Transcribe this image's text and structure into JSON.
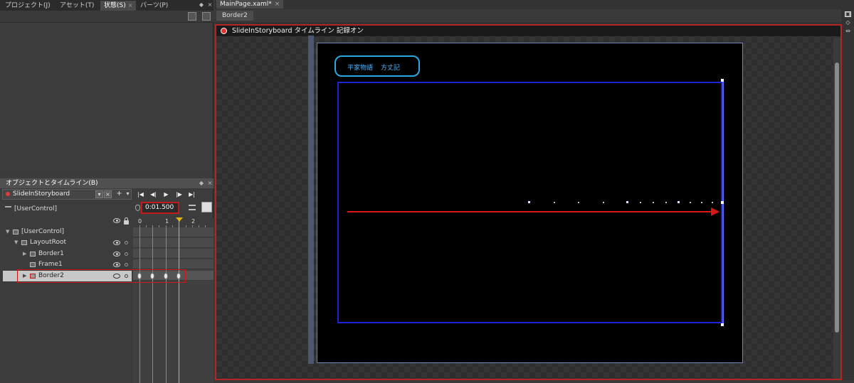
{
  "top_tabs": [
    {
      "label": "プロジェクト(J)"
    },
    {
      "label": "アセット(T)"
    },
    {
      "label": "状態(S)"
    },
    {
      "label": "パーツ(P)"
    }
  ],
  "objects_panel": {
    "title": "オブジェクトとタイムライン(B)",
    "storyboard": "SlideInStoryboard",
    "root": "[UserControl]",
    "time": "0:01.500",
    "ruler": [
      "0",
      "1",
      "2"
    ],
    "tree": [
      {
        "label": "[UserControl]"
      },
      {
        "label": "LayoutRoot"
      },
      {
        "label": "Border1"
      },
      {
        "label": "Frame1"
      },
      {
        "label": "Border2"
      }
    ]
  },
  "document": {
    "tab": "MainPage.xaml*",
    "breadcrumb": "Border2",
    "recording_banner": "SlideInStoryboard タイムライン 記録オン",
    "nav_links": [
      "平家物語",
      "方丈記"
    ]
  },
  "colors": {
    "record": "#e53434",
    "highlight_box": "#d01818",
    "border2": "#1a24d0",
    "link": "#4fb3ff",
    "playhead": "#e0b418"
  }
}
